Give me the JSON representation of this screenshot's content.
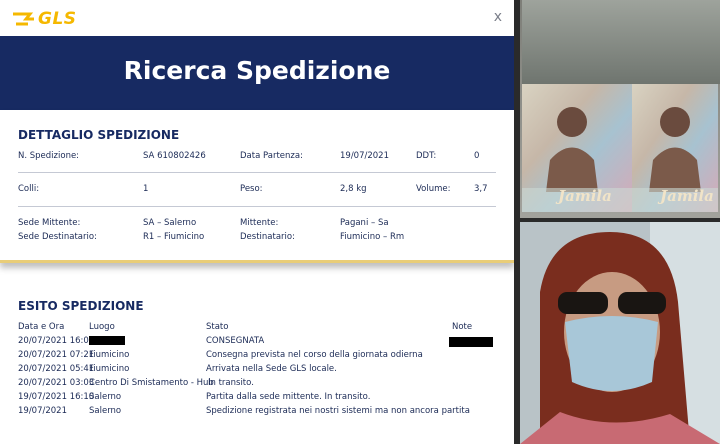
{
  "brand": {
    "name": "GLS",
    "color": "#f5b800"
  },
  "window": {
    "close_label": "x"
  },
  "banner": {
    "title": "Ricerca Spedizione",
    "bg": "#172a62"
  },
  "detail": {
    "title": "DETTAGLIO SPEDIZIONE",
    "n_spedizione_label": "N. Spedizione:",
    "n_spedizione_value": "SA 610802426",
    "data_partenza_label": "Data Partenza:",
    "data_partenza_value": "19/07/2021",
    "ddt_label": "DDT:",
    "ddt_value": "0",
    "colli_label": "Colli:",
    "colli_value": "1",
    "peso_label": "Peso:",
    "peso_value": "2,8 kg",
    "volume_label": "Volume:",
    "volume_value": "3,7",
    "sede_mittente_label": "Sede Mittente:",
    "sede_mittente_value": "SA – Salerno",
    "mittente_label": "Mittente:",
    "mittente_value": "Pagani – Sa",
    "sede_destinatario_label": "Sede Destinatario:",
    "sede_destinatario_value": "R1 – Fiumicino",
    "destinatario_label": "Destinatario:",
    "destinatario_value": "Fiumicino – Rm"
  },
  "esito": {
    "title": "ESITO SPEDIZIONE",
    "columns": {
      "data": "Data e Ora",
      "luogo": "Luogo",
      "stato": "Stato",
      "note": "Note"
    },
    "rows": [
      {
        "data": "20/07/2021 16:05",
        "luogo": "",
        "stato": "CONSEGNATA",
        "note": ""
      },
      {
        "data": "20/07/2021 07:21",
        "luogo": "Fiumicino",
        "stato": "Consegna prevista nel corso della giornata odierna",
        "note": ""
      },
      {
        "data": "20/07/2021 05:41",
        "luogo": "Fiumicino",
        "stato": "Arrivata nella Sede GLS locale.",
        "note": ""
      },
      {
        "data": "20/07/2021 03:03",
        "luogo": "Centro Di Smistamento - Hub",
        "stato": "In transito.",
        "note": ""
      },
      {
        "data": "19/07/2021 16:10",
        "luogo": "Salerno",
        "stato": "Partita dalla sede mittente. In transito.",
        "note": ""
      },
      {
        "data": "19/07/2021",
        "luogo": "Salerno",
        "stato": "Spedizione registrata nei nostri sistemi ma non ancora partita",
        "note": ""
      }
    ]
  },
  "photo_top": {
    "product_label": "Jamila"
  },
  "colors": {
    "navy": "#172a62",
    "accent_gold": "#e9cd78"
  }
}
